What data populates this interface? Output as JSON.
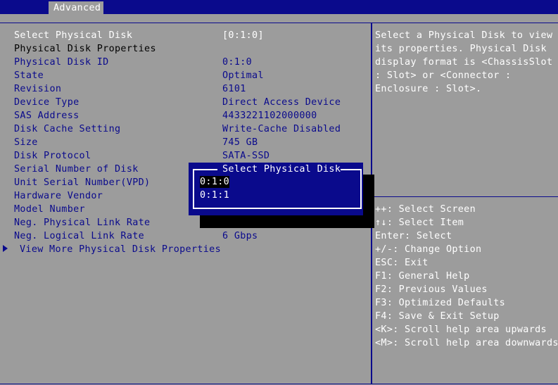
{
  "header": {
    "tab_label": "Advanced"
  },
  "rows": [
    {
      "label": "Select Physical Disk",
      "value": "[0:1:0]"
    },
    {
      "label": "Physical Disk Properties",
      "value": ""
    },
    {
      "label": "Physical Disk ID",
      "value": "0:1:0"
    },
    {
      "label": "State",
      "value": "Optimal"
    },
    {
      "label": "Revision",
      "value": "6101"
    },
    {
      "label": "Device Type",
      "value": "Direct Access Device"
    },
    {
      "label": "SAS Address",
      "value": "4433221102000000"
    },
    {
      "label": "Disk Cache Setting",
      "value": "Write-Cache Disabled"
    },
    {
      "label": "Size",
      "value": "745 GB"
    },
    {
      "label": "Disk Protocol",
      "value": "SATA-SSD"
    },
    {
      "label": "Serial Number of Disk",
      "value": ""
    },
    {
      "label": "Unit Serial Number(VPD)",
      "value": ""
    },
    {
      "label": "Hardware Vendor",
      "value": ""
    },
    {
      "label": "Model Number",
      "value": ""
    },
    {
      "label": "Neg. Physical Link Rate",
      "value": ""
    },
    {
      "label": "Neg. Logical Link Rate",
      "value": "6 Gbps"
    },
    {
      "label": "View More Physical Disk Properties",
      "value": ""
    }
  ],
  "help": {
    "text": "Select a Physical Disk to view\nits properties. Physical Disk\ndisplay format is <ChassisSlot\n: Slot> or <Connector :\nEnclosure : Slot>."
  },
  "keys": [
    "++: Select Screen",
    "↑↓: Select Item",
    "Enter: Select",
    "+/-: Change Option",
    "ESC: Exit",
    "F1: General Help",
    "F2: Previous Values",
    "F3: Optimized Defaults",
    "F4: Save & Exit Setup",
    "<K>: Scroll help area upwards",
    "<M>: Scroll help area downwards"
  ],
  "popup": {
    "title": "Select Physical Disk",
    "options": [
      "0:1:0",
      "0:1:1"
    ],
    "selected": "0:1:0"
  },
  "colors": {
    "background": "#9c9c9c",
    "bios_blue": "#0a0a8c",
    "text_white": "#ffffff",
    "highlight_black": "#000000"
  }
}
